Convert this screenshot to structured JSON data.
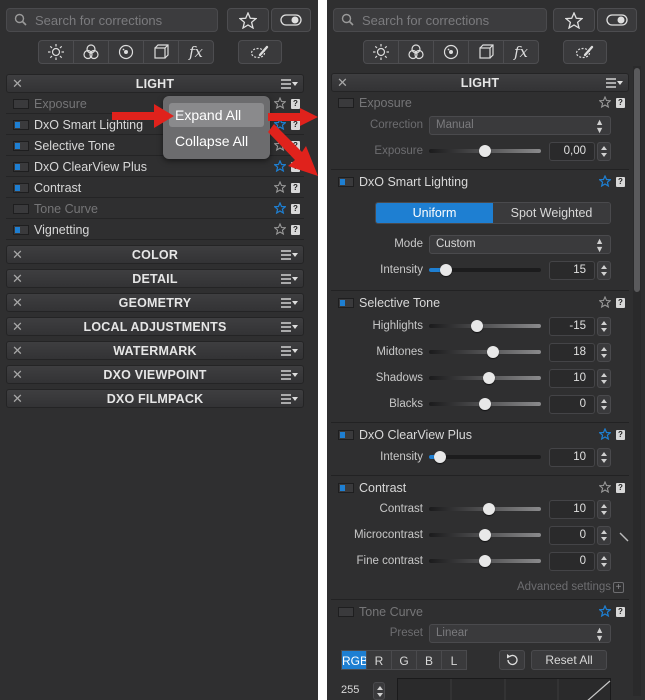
{
  "search": {
    "placeholder": "Search for corrections"
  },
  "colors": {
    "accent": "#1e7fd2",
    "panel_bg": "#2f2f30",
    "arrow_red": "#e0221c"
  },
  "tools": [
    "light-icon",
    "color-icon",
    "detail-icon",
    "geometry-icon",
    "fx-icon",
    "local-adjust-icon"
  ],
  "left": {
    "light_title": "LIGHT",
    "light_items": [
      {
        "label": "Exposure",
        "enabled": false,
        "fav": false
      },
      {
        "label": "DxO Smart Lighting",
        "enabled": true,
        "fav": true
      },
      {
        "label": "Selective Tone",
        "enabled": true,
        "fav": false
      },
      {
        "label": "DxO ClearView Plus",
        "enabled": true,
        "fav": true
      },
      {
        "label": "Contrast",
        "enabled": true,
        "fav": false
      },
      {
        "label": "Tone Curve",
        "enabled": false,
        "fav": true
      },
      {
        "label": "Vignetting",
        "enabled": true,
        "fav": false
      }
    ],
    "palettes": [
      "COLOR",
      "DETAIL",
      "GEOMETRY",
      "LOCAL ADJUSTMENTS",
      "WATERMARK",
      "DXO VIEWPOINT",
      "DXO FILMPACK"
    ],
    "menu": {
      "expand_all": "Expand All",
      "collapse_all": "Collapse All"
    }
  },
  "right": {
    "light_title": "LIGHT",
    "exposure": {
      "label": "Exposure",
      "correction_label": "Correction",
      "correction_value": "Manual",
      "exposure_label": "Exposure",
      "exposure_value": "0,00",
      "slider": 0.5
    },
    "smart_lighting": {
      "label": "DxO Smart Lighting",
      "uniform": "Uniform",
      "spot_weighted": "Spot Weighted",
      "mode_label": "Mode",
      "mode_value": "Custom",
      "intensity_label": "Intensity",
      "intensity_value": "15",
      "slider": 0.15
    },
    "selective_tone": {
      "label": "Selective Tone",
      "params": [
        {
          "label": "Highlights",
          "value": "-15",
          "slider": 0.43
        },
        {
          "label": "Midtones",
          "value": "18",
          "slider": 0.57
        },
        {
          "label": "Shadows",
          "value": "10",
          "slider": 0.54
        },
        {
          "label": "Blacks",
          "value": "0",
          "slider": 0.5
        }
      ]
    },
    "clearview": {
      "label": "DxO ClearView Plus",
      "intensity_label": "Intensity",
      "intensity_value": "10",
      "slider": 0.1
    },
    "contrast": {
      "label": "Contrast",
      "params": [
        {
          "label": "Contrast",
          "value": "10",
          "slider": 0.54
        },
        {
          "label": "Microcontrast",
          "value": "0",
          "slider": 0.5
        },
        {
          "label": "Fine contrast",
          "value": "0",
          "slider": 0.5
        }
      ],
      "advanced": "Advanced settings"
    },
    "tone_curve": {
      "label": "Tone Curve",
      "preset_label": "Preset",
      "preset_value": "Linear",
      "channels": [
        "RGB",
        "R",
        "G",
        "B",
        "L"
      ],
      "reset_all": "Reset All",
      "value": "255"
    }
  }
}
